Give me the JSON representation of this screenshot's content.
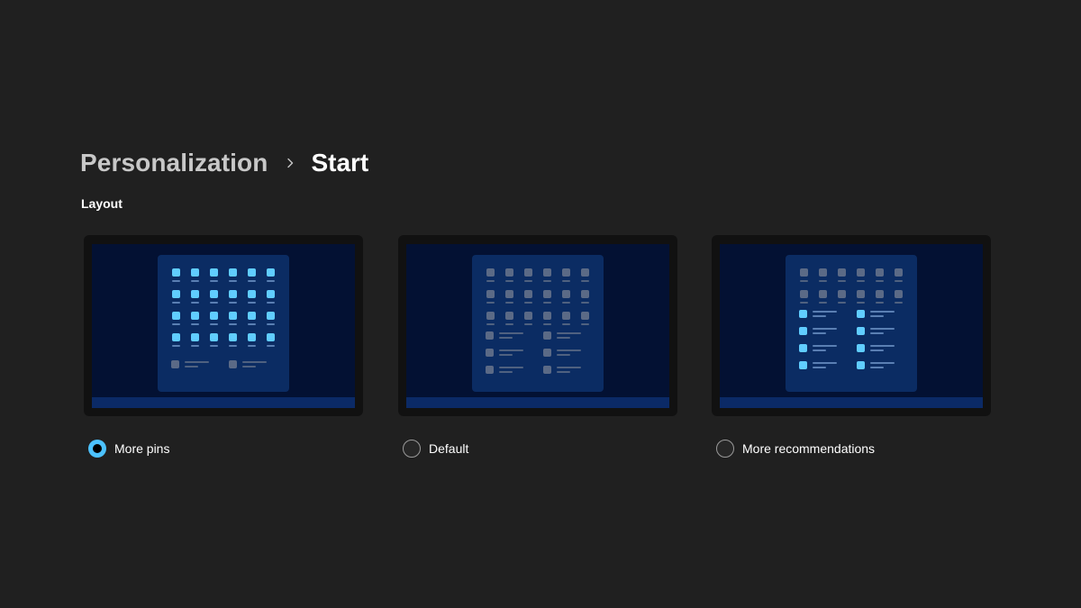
{
  "breadcrumb": {
    "parent": "Personalization",
    "separator_icon": "chevron-right-icon",
    "current": "Start"
  },
  "section": {
    "label": "Layout"
  },
  "colors": {
    "background": "#202020",
    "accent": "#4cc2ff",
    "screen": "#031133",
    "taskbar": "#0b2a66",
    "start_menu": "#0b2c63",
    "icon_active": "#60cdff",
    "icon_inactive": "#5b6a86",
    "line_active": "#5a7fb3",
    "line_inactive": "#4f6180"
  },
  "layouts": [
    {
      "id": "more-pins",
      "label": "More pins",
      "selected": true,
      "preview": {
        "pinned_rows": 4,
        "recommendation_rows": 1,
        "pins_highlighted": true,
        "recs_highlighted": false
      }
    },
    {
      "id": "default",
      "label": "Default",
      "selected": false,
      "preview": {
        "pinned_rows": 3,
        "recommendation_rows": 3,
        "pins_highlighted": false,
        "recs_highlighted": false
      }
    },
    {
      "id": "more-recommendations",
      "label": "More recommendations",
      "selected": false,
      "preview": {
        "pinned_rows": 2,
        "recommendation_rows": 4,
        "pins_highlighted": false,
        "recs_highlighted": true
      }
    }
  ]
}
